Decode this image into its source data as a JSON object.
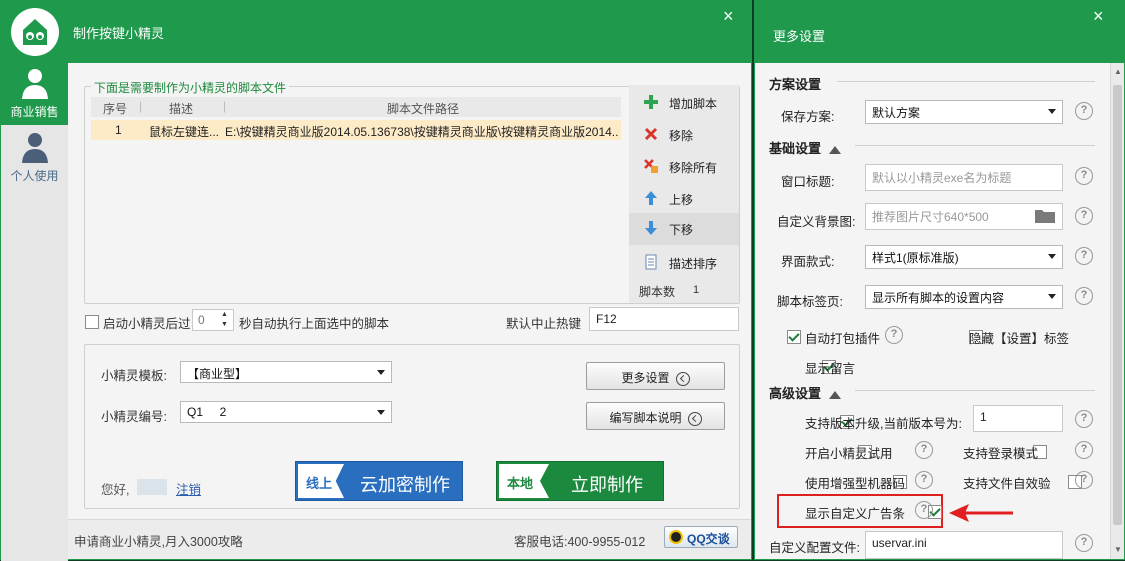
{
  "left": {
    "title": "制作按键小精灵",
    "close": "×",
    "sidebar": [
      {
        "label": "商业销售"
      },
      {
        "label": "个人使用"
      }
    ],
    "script_group": {
      "legend": "下面是需要制作为小精灵的脚本文件",
      "columns": [
        "序号",
        "描述",
        "脚本文件路径"
      ],
      "rows": [
        {
          "num": "1",
          "desc": "鼠标左键连...",
          "path": "E:\\按键精灵商业版2014.05.136738\\按键精灵商业版\\按键精灵商业版2014.."
        }
      ]
    },
    "toolbar": {
      "add": "增加脚本",
      "remove": "移除",
      "remove_all": "移除所有",
      "up": "上移",
      "down": "下移",
      "sort": "描述排序",
      "count_label": "脚本数",
      "count": "1"
    },
    "auto_run": {
      "prefix": "启动小精灵后过",
      "seconds": "0",
      "suffix": "秒自动执行上面选中的脚本"
    },
    "hotkey": {
      "label": "默认中止热键",
      "value": "F12"
    },
    "template": {
      "label": "小精灵模板:",
      "value": "【商业型】"
    },
    "serial": {
      "label": "小精灵编号:",
      "value": "Q1     2"
    },
    "more_btn": "更多设置",
    "write_btn": "编写脚本说明",
    "greeting": "您好,",
    "logout": "注销",
    "online_btn": {
      "tag": "线上",
      "label": "云加密制作"
    },
    "local_btn": {
      "tag": "本地",
      "label": "立即制作"
    },
    "footer": {
      "left": "申请商业小精灵,月入3000攻略",
      "phone": "客服电话:400-9955-012",
      "qq": "QQ交谈"
    }
  },
  "right": {
    "title": "更多设置",
    "close": "×",
    "scheme": {
      "section": "方案设置",
      "save_label": "保存方案:",
      "save_value": "默认方案"
    },
    "basic": {
      "section": "基础设置",
      "window_title": {
        "label": "窗口标题:",
        "placeholder": "默认以小精灵exe名为标题"
      },
      "bg": {
        "label": "自定义背景图:",
        "placeholder": "推荐图片尺寸640*500"
      },
      "ui": {
        "label": "界面款式:",
        "value": "样式1(原标准版)"
      },
      "tab": {
        "label": "脚本标签页:",
        "value": "显示所有脚本的设置内容"
      },
      "auto_pack": "自动打包插件",
      "hide_tab": "隐藏【设置】标签",
      "show_msg": "显示留言"
    },
    "advanced": {
      "section": "高级设置",
      "upgrade": {
        "label": "支持版本升级,当前版本号为:",
        "value": "1"
      },
      "trial": "开启小精灵试用",
      "login": "支持登录模式",
      "machine": "使用增强型机器码",
      "selfcheck": "支持文件自效验",
      "ad": "显示自定义广告条",
      "config": {
        "label": "自定义配置文件:",
        "value": "uservar.ini"
      }
    },
    "help": "?"
  },
  "colors": {
    "brand": "#1f9a4c",
    "annotation_arrow": "#e02020",
    "online": "#2a6fbf",
    "local": "#1c8a3e"
  }
}
